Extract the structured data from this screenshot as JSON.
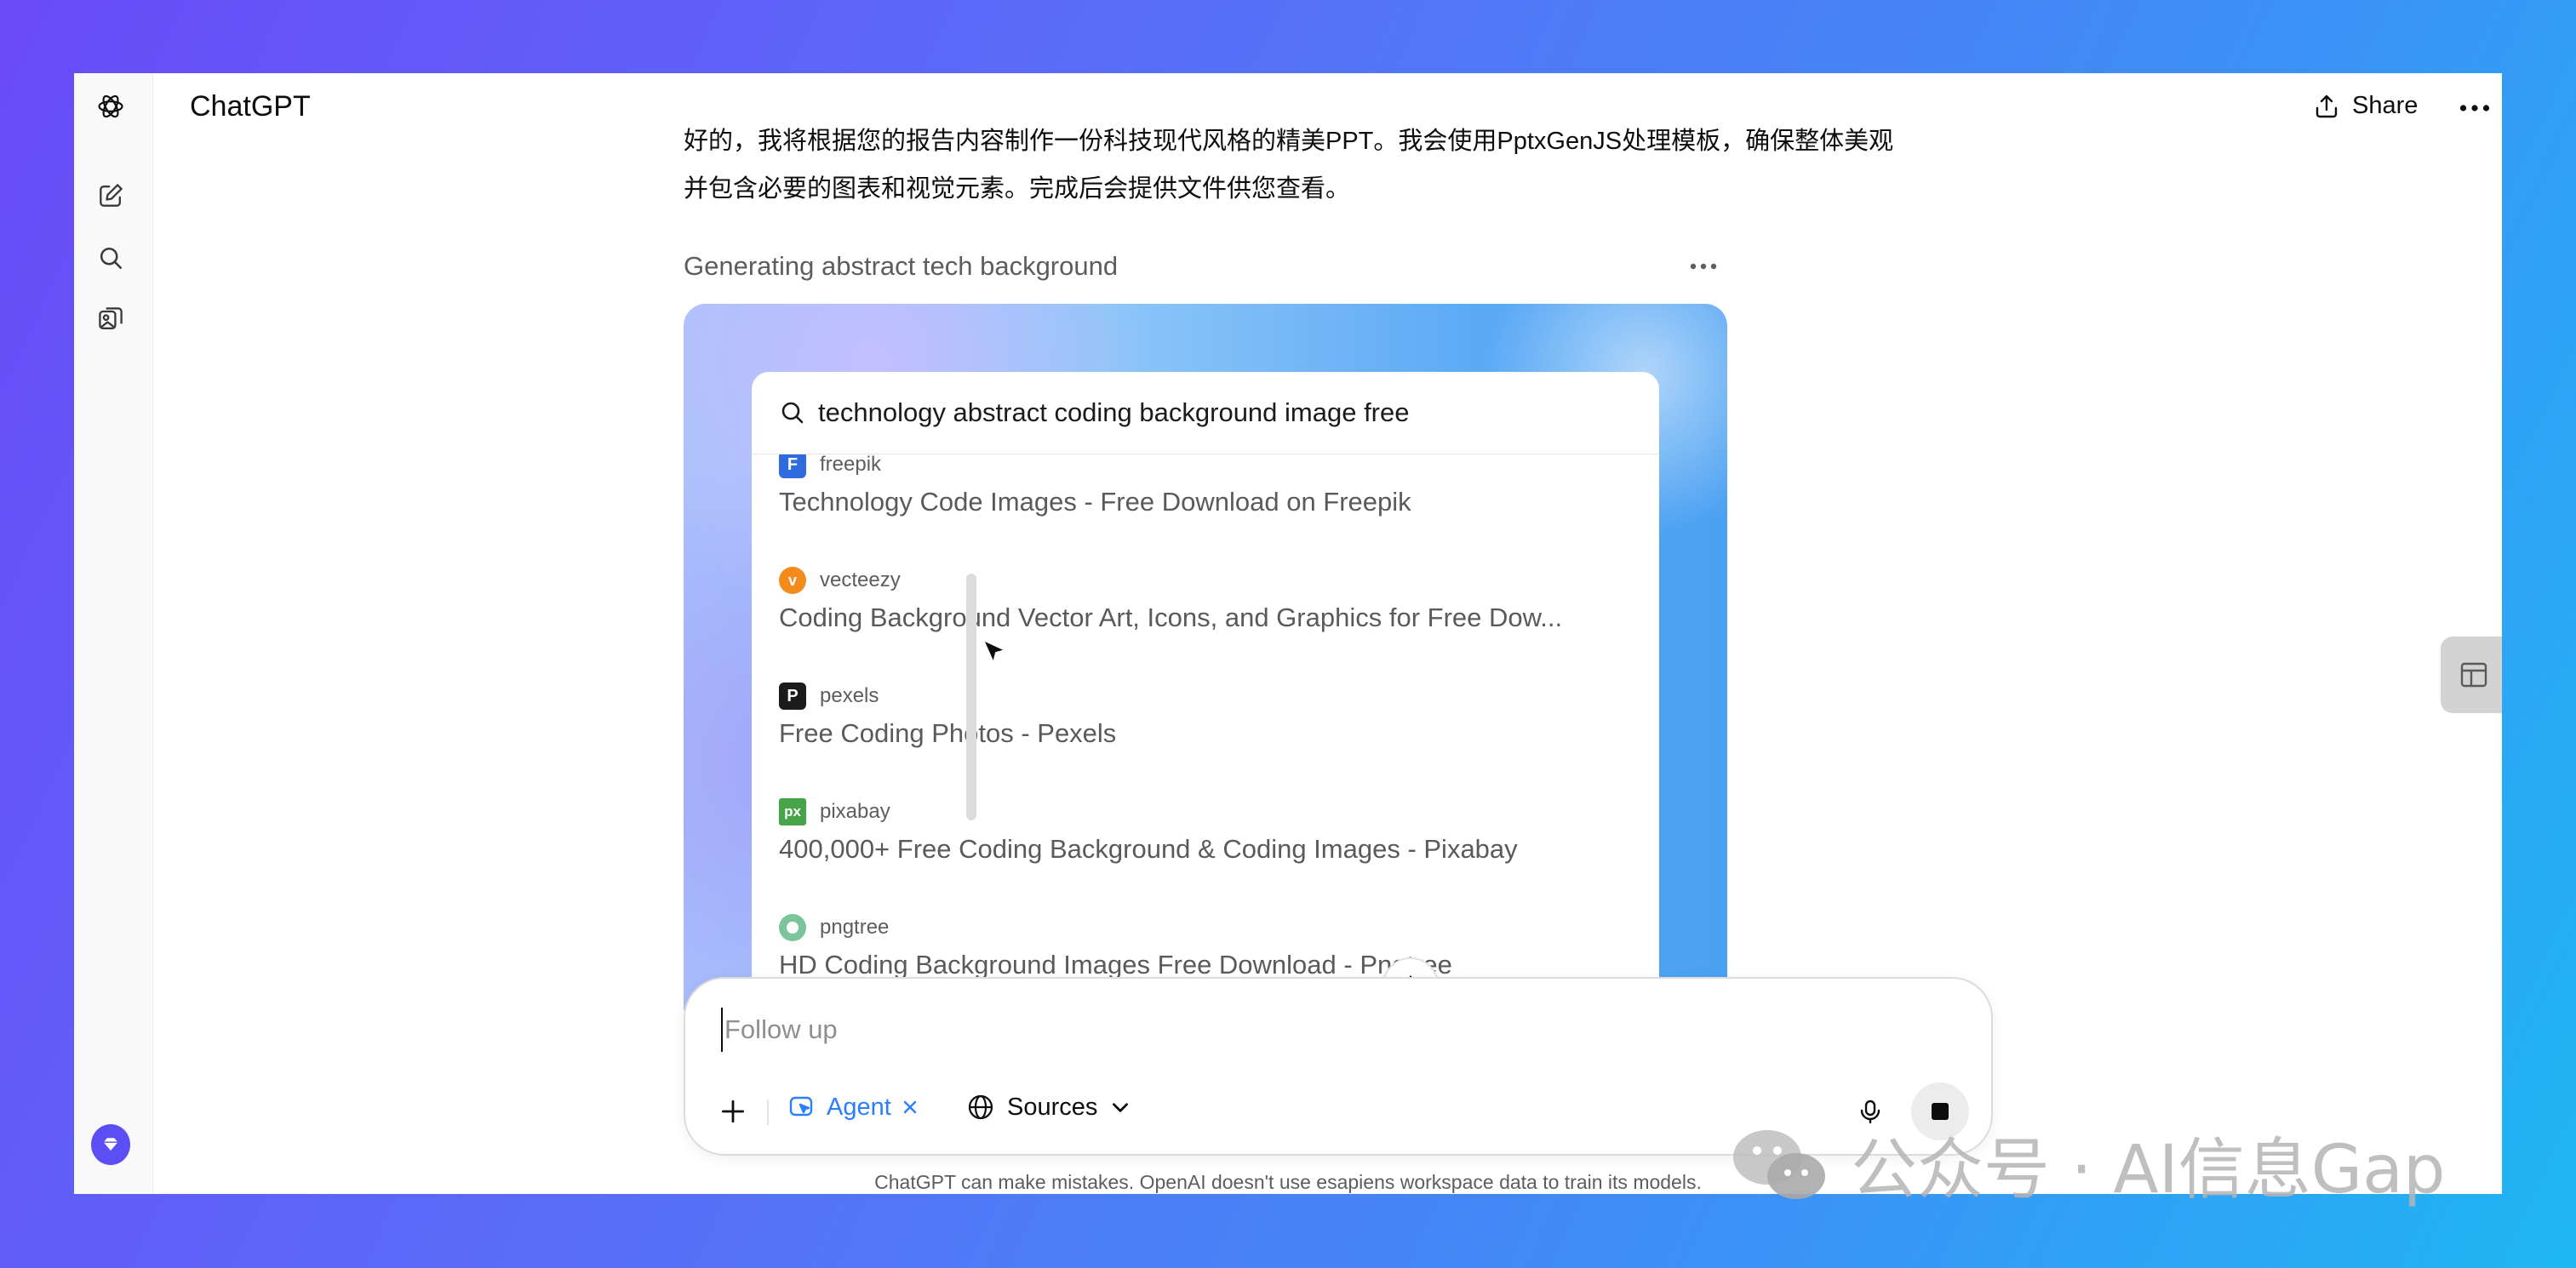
{
  "header": {
    "app_title": "ChatGPT",
    "share_label": "Share"
  },
  "sidebar": {
    "items": [
      {
        "name": "openai-logo-icon"
      },
      {
        "name": "new-chat-icon"
      },
      {
        "name": "search-icon"
      },
      {
        "name": "library-icon"
      },
      {
        "name": "upgrade-icon"
      }
    ]
  },
  "message": {
    "lines": [
      "好的，我将根据您的报告内容制作一份科技现代风格的精美PPT。我会使用PptxGenJS处理模板，确保整体美观",
      "并包含必要的图表和视觉元素。完成后会提供文件供您查看。"
    ]
  },
  "task": {
    "label": "Generating abstract tech background"
  },
  "browser": {
    "query": "technology abstract coding background image free",
    "results": [
      {
        "source": "freepik",
        "title": "Technology Code Images - Free Download on Freepik",
        "favicon_color": "#2f6bdf"
      },
      {
        "source": "vecteezy",
        "title": "Coding Background Vector Art, Icons, and Graphics for Free Dow...",
        "favicon_color": "#f28a1c"
      },
      {
        "source": "pexels",
        "title": "Free Coding Photos - Pexels",
        "favicon_color": "#1b1b1b"
      },
      {
        "source": "pixabay",
        "title": "400,000+ Free Coding Background & Coding Images - Pixabay",
        "favicon_color": "#48a448"
      },
      {
        "source": "pngtree",
        "title": "HD Coding Background Images Free Download - Pngtree",
        "favicon_color": "#7cc49a"
      }
    ]
  },
  "composer": {
    "placeholder": "Follow up",
    "agent_label": "Agent",
    "sources_label": "Sources"
  },
  "footer": {
    "disclaimer": "ChatGPT can make mistakes. OpenAI doesn't use esapiens workspace data to train its models."
  },
  "watermark": {
    "text": "公众号 · AI信息Gap"
  },
  "colors": {
    "accent": "#2a7fff",
    "upgrade": "#5b4ef5"
  }
}
